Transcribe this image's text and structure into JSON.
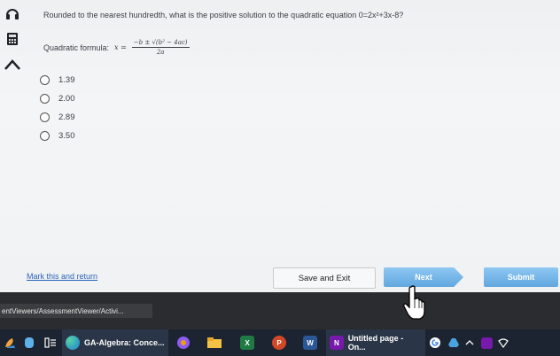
{
  "question": {
    "text": "Rounded to the nearest hundredth, what is the positive solution to the quadratic equation 0=2x²+3x-8?"
  },
  "formula": {
    "label": "Quadratic formula:",
    "lhs": "x =",
    "numerator": "−b ± √(b² − 4ac)",
    "denominator": "2a"
  },
  "choices": [
    {
      "label": "1.39"
    },
    {
      "label": "2.00"
    },
    {
      "label": "2.89"
    },
    {
      "label": "3.50"
    }
  ],
  "footer": {
    "mark_link": "Mark this and return",
    "save_exit": "Save and Exit",
    "next": "Next",
    "submit": "Submit"
  },
  "status_url": "entViewers/AssessmentViewer/Activi...",
  "taskbar": {
    "edge_window": "GA-Algebra: Conce...",
    "onenote_window": "Untitled page - On...",
    "excel_letter": "X",
    "ppt_letter": "P",
    "word_letter": "W",
    "onenote_letter": "N"
  },
  "colors": {
    "accent": "#61a7df",
    "link": "#2b63b6",
    "taskbar": "#1c2431"
  },
  "icons": [
    "headphones-icon",
    "calculator-icon",
    "arrow-up-icon",
    "windows-icon",
    "search-icon",
    "task-view-icon",
    "edge-icon",
    "chrome-icon",
    "folder-icon",
    "excel-icon",
    "powerpoint-icon",
    "word-icon",
    "onenote-icon",
    "google-icon",
    "drive-icon",
    "chevron-icon",
    "wifi-icon"
  ]
}
